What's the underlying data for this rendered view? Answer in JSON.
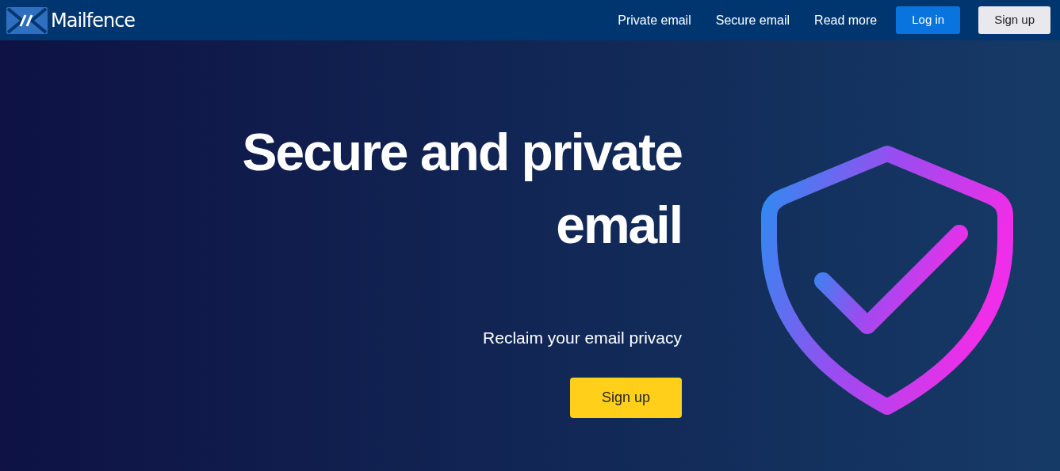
{
  "navbar": {
    "brand": "Mailfence",
    "links": [
      {
        "label": "Private email"
      },
      {
        "label": "Secure email"
      },
      {
        "label": "Read more"
      }
    ],
    "buttons": [
      {
        "label": "Log in",
        "kind": "primary"
      },
      {
        "label": "Sign up",
        "kind": "light"
      }
    ]
  },
  "hero": {
    "title": "Secure and private email",
    "subtitle": "Reclaim your email privacy",
    "cta": "Sign up"
  }
}
